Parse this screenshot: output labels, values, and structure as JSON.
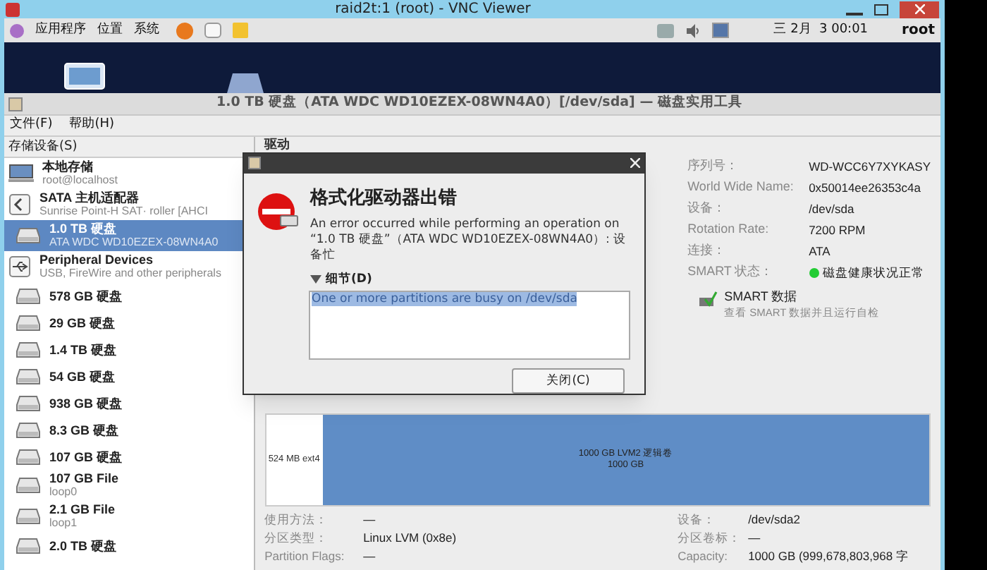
{
  "vnc_window": {
    "title": "raid2t:1 (root) - VNC Viewer"
  },
  "top_panel": {
    "menus": [
      "应用程序",
      "位置",
      "系统"
    ],
    "clock": "三 2月  3 00:01",
    "user": "root"
  },
  "app_window": {
    "title": "1.0 TB 硬盘（ATA WDC WD10EZEX-08WN4A0）[/dev/sda] — 磁盘实用工具",
    "menus": [
      "文件(F)",
      "帮助(H)"
    ]
  },
  "sidebar": {
    "header": "存储设备(S)",
    "items": [
      {
        "kind": "host",
        "name": "本地存储",
        "sub": "root@localhost",
        "selected": false,
        "children": [
          {
            "kind": "adapter",
            "name": "SATA 主机适配器",
            "sub": "Sunrise Point-H SAT· roller [AHCI",
            "selected": false,
            "children": [
              {
                "kind": "disk",
                "name": "1.0 TB 硬盘",
                "sub": "ATA WDC WD10EZEX-08WN4A0",
                "selected": true
              }
            ]
          },
          {
            "kind": "usb",
            "name": "Peripheral Devices",
            "sub": "USB, FireWire and other peripherals",
            "selected": false,
            "children": [
              {
                "kind": "disk",
                "name": "578 GB 硬盘",
                "selected": false
              },
              {
                "kind": "disk",
                "name": "29 GB 硬盘",
                "selected": false
              },
              {
                "kind": "disk",
                "name": "1.4 TB 硬盘",
                "selected": false
              },
              {
                "kind": "disk",
                "name": "54 GB 硬盘",
                "selected": false
              },
              {
                "kind": "disk",
                "name": "938 GB 硬盘",
                "selected": false
              },
              {
                "kind": "disk",
                "name": "8.3 GB 硬盘",
                "selected": false
              },
              {
                "kind": "disk",
                "name": "107 GB 硬盘",
                "selected": false
              },
              {
                "kind": "disk",
                "name": "107 GB File",
                "sub": "loop0",
                "selected": false
              },
              {
                "kind": "disk",
                "name": "2.1 GB File",
                "sub": "loop1",
                "selected": false
              },
              {
                "kind": "disk",
                "name": "2.0 TB 硬盘",
                "selected": false
              }
            ]
          }
        ]
      }
    ]
  },
  "drive": {
    "header": "驱动",
    "fields": [
      {
        "label": "序列号：",
        "value": "WD-WCC6Y7XYKASY"
      },
      {
        "label": "World Wide Name:",
        "value": "0x50014ee26353c4a"
      },
      {
        "label": "设备：",
        "value": "/dev/sda"
      },
      {
        "label": "Rotation Rate:",
        "value": "7200 RPM"
      },
      {
        "label": "连接：",
        "value": "ATA"
      },
      {
        "label": "SMART 状态：",
        "value": "磁盘健康状况正常",
        "color": "#22cc33"
      }
    ],
    "smart": {
      "title": "SMART 数据",
      "subtitle": "查看 SMART 数据并且运行自检"
    }
  },
  "partitions": [
    {
      "label": "524 MB ext4",
      "selected": false
    },
    {
      "label": "1000 GB LVM2 逻辑卷",
      "size": "1000 GB",
      "selected": true
    }
  ],
  "volume": {
    "left": [
      {
        "label": "使用方法：",
        "value": "—"
      },
      {
        "label": "分区类型：",
        "value": "Linux LVM (0x8e)"
      },
      {
        "label": "Partition Flags:",
        "value": "—"
      }
    ],
    "right": [
      {
        "label": "设备：",
        "value": "/dev/sda2"
      },
      {
        "label": "分区卷标：",
        "value": "—"
      },
      {
        "label": "Capacity:",
        "value": "1000 GB (999,678,803,968 字"
      }
    ]
  },
  "dialog": {
    "title": "格式化驱动器出错",
    "message": "An error occurred while performing an operation on “1.0 TB 硬盘”（ATA WDC WD10EZEX-08WN4A0）: 设备忙",
    "details_label": "细节(D)",
    "expanded": true,
    "details_text": "One or more partitions are busy on /dev/sda",
    "button": "关闭(C)"
  }
}
